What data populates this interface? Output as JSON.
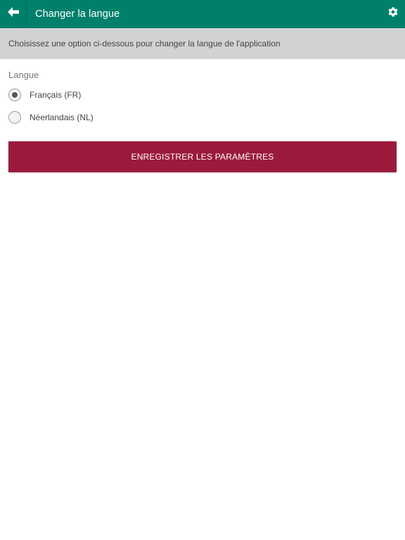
{
  "header": {
    "title": "Changer la langue",
    "back_icon": "arrow-left-icon",
    "settings_icon": "gear-icon"
  },
  "banner": {
    "text": "Choisissez une option ci-dessous pour changer la langue de l'application"
  },
  "language": {
    "section_label": "Langue",
    "options": [
      {
        "label": "Français (FR)",
        "selected": true
      },
      {
        "label": "Néerlandais (NL)",
        "selected": false
      }
    ]
  },
  "actions": {
    "save_label": "ENREGISTRER LES PARAMÈTRES"
  },
  "colors": {
    "header_bg": "#00806a",
    "banner_bg": "#d2d2d2",
    "button_bg": "#9b1a3c"
  }
}
